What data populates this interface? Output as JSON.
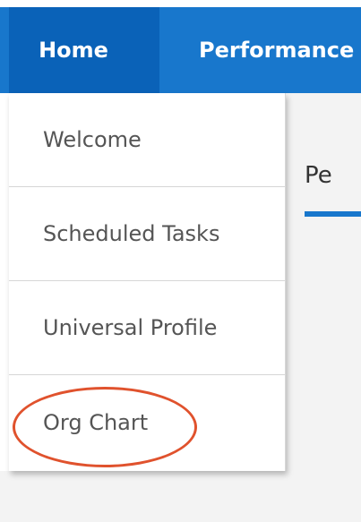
{
  "nav": {
    "home_label": "Home",
    "performance_label": "Performance"
  },
  "content": {
    "tab_label": "Pe"
  },
  "menu": {
    "items": [
      {
        "label": "Welcome"
      },
      {
        "label": "Scheduled Tasks"
      },
      {
        "label": "Universal Profile"
      },
      {
        "label": "Org Chart"
      }
    ]
  },
  "colors": {
    "nav_bar": "#1877cc",
    "nav_active": "#0a62b8",
    "annotation": "#e0522d"
  }
}
